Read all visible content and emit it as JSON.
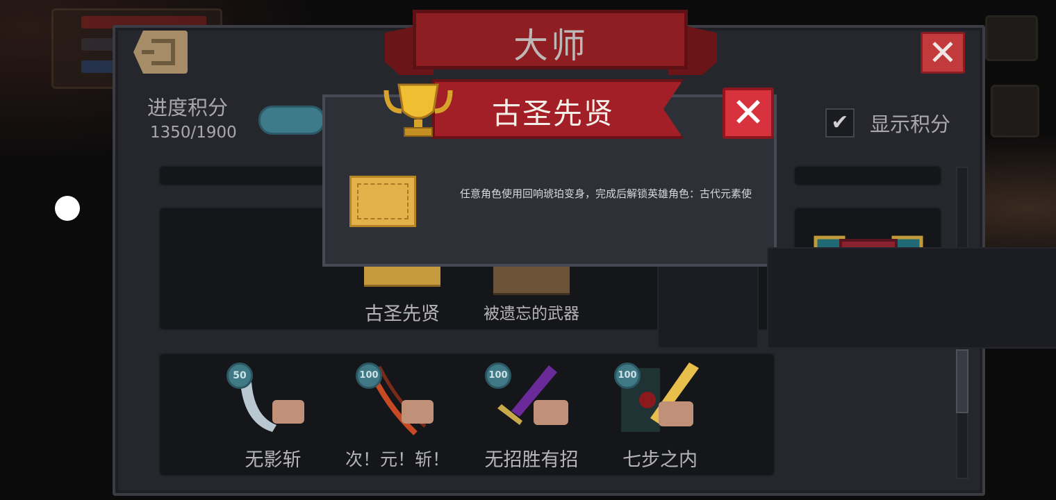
{
  "panel": {
    "title": "大师",
    "progress_label": "进度积分",
    "progress_value": "1350/1900",
    "show_score_label": "显示积分",
    "show_score_checked": true
  },
  "achievements_row2": [
    {
      "name": "古圣先贤"
    },
    {
      "name": "被遗忘的武器"
    }
  ],
  "achievements_row3": [
    {
      "name": "无影斩",
      "points": "50"
    },
    {
      "name": "次！元！斩！",
      "points": "100"
    },
    {
      "name": "无招胜有招",
      "points": "100"
    },
    {
      "name": "七步之内",
      "points": "100"
    }
  ],
  "dialog": {
    "title": "古圣先贤",
    "description": "任意角色使用回响琥珀变身，完成后解锁英雄角色：古代元素使"
  },
  "colors": {
    "banner_red": "#a31f27",
    "close_red": "#d8323e",
    "badge_teal": "#3f7986",
    "panel_bg": "#26272d"
  },
  "icons": [
    "back-icon",
    "close-icon",
    "trophy-icon",
    "check-icon",
    "chest-icon",
    "scroll-icon"
  ]
}
